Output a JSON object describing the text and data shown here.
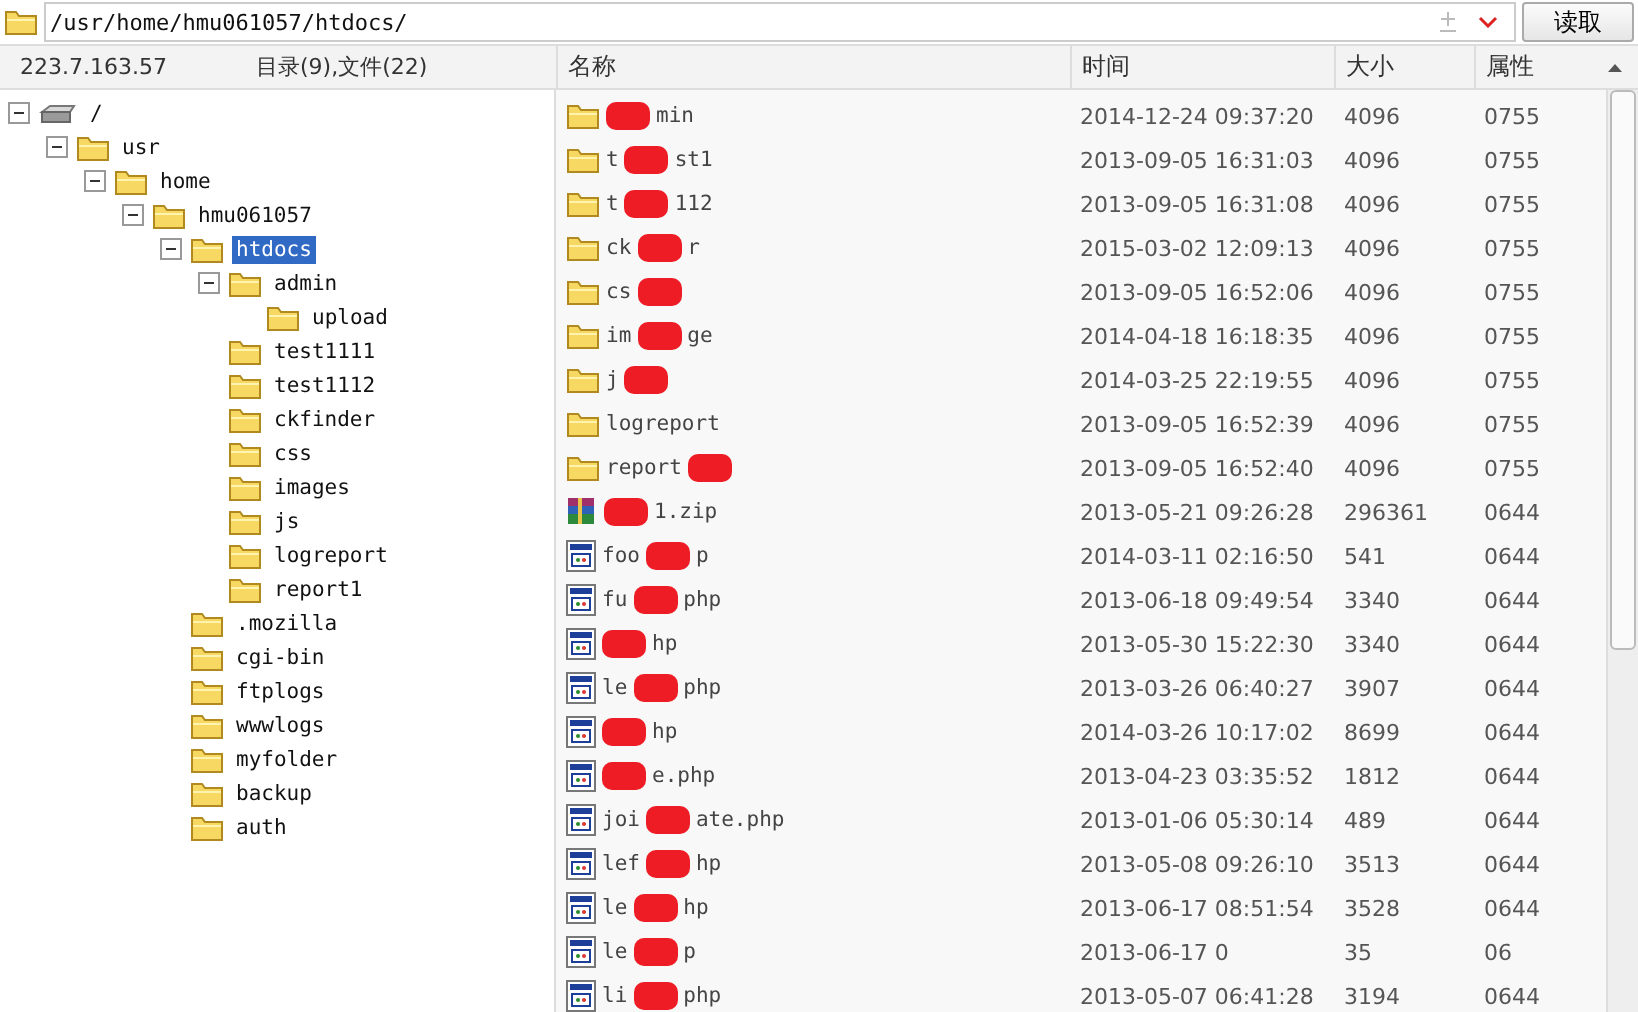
{
  "address_bar": {
    "path": "/usr/home/hmu061057/htdocs/",
    "button": "读取"
  },
  "status": {
    "host": "223.7.163.57",
    "counts": "目录(9),文件(22)"
  },
  "tree": [
    {
      "label": "/",
      "kind": "drive",
      "expanded": true,
      "selected": false,
      "children": [
        {
          "label": "usr",
          "kind": "folder",
          "expanded": true,
          "selected": false,
          "children": [
            {
              "label": "home",
              "kind": "folder",
              "expanded": true,
              "selected": false,
              "children": [
                {
                  "label": "hmu061057",
                  "kind": "folder",
                  "expanded": true,
                  "selected": false,
                  "children": [
                    {
                      "label": "htdocs",
                      "kind": "folder",
                      "expanded": true,
                      "selected": true,
                      "children": [
                        {
                          "label": "admin",
                          "kind": "folder",
                          "expanded": true,
                          "selected": false,
                          "children": [
                            {
                              "label": "upload",
                              "kind": "folder",
                              "selected": false
                            }
                          ]
                        },
                        {
                          "label": "test1111",
                          "kind": "folder",
                          "selected": false
                        },
                        {
                          "label": "test1112",
                          "kind": "folder",
                          "selected": false
                        },
                        {
                          "label": "ckfinder",
                          "kind": "folder",
                          "selected": false
                        },
                        {
                          "label": "css",
                          "kind": "folder",
                          "selected": false
                        },
                        {
                          "label": "images",
                          "kind": "folder",
                          "selected": false
                        },
                        {
                          "label": "js",
                          "kind": "folder",
                          "selected": false
                        },
                        {
                          "label": "logreport",
                          "kind": "folder",
                          "selected": false
                        },
                        {
                          "label": "report1",
                          "kind": "folder",
                          "selected": false
                        }
                      ]
                    },
                    {
                      "label": ".mozilla",
                      "kind": "folder",
                      "selected": false
                    },
                    {
                      "label": "cgi-bin",
                      "kind": "folder",
                      "selected": false
                    },
                    {
                      "label": "ftplogs",
                      "kind": "folder",
                      "selected": false
                    },
                    {
                      "label": "wwwlogs",
                      "kind": "folder",
                      "selected": false
                    },
                    {
                      "label": "myfolder",
                      "kind": "folder",
                      "selected": false
                    },
                    {
                      "label": "backup",
                      "kind": "folder",
                      "selected": false
                    },
                    {
                      "label": "auth",
                      "kind": "folder",
                      "selected": false
                    }
                  ]
                }
              ]
            }
          ]
        }
      ]
    }
  ],
  "table": {
    "columns": [
      "名称",
      "时间",
      "大小",
      "属性"
    ],
    "rows": [
      {
        "kind": "folder",
        "name_before": "",
        "name_after": "min",
        "redacted": true,
        "time": "2014-12-24 09:37:20",
        "size": "4096",
        "mode": "0755"
      },
      {
        "kind": "folder",
        "name_before": "t",
        "name_after": "st1",
        "redacted": true,
        "time": "2013-09-05 16:31:03",
        "size": "4096",
        "mode": "0755"
      },
      {
        "kind": "folder",
        "name_before": "t",
        "name_after": "112",
        "redacted": true,
        "time": "2013-09-05 16:31:08",
        "size": "4096",
        "mode": "0755"
      },
      {
        "kind": "folder",
        "name_before": "ck",
        "name_after": "r",
        "redacted": true,
        "time": "2015-03-02 12:09:13",
        "size": "4096",
        "mode": "0755"
      },
      {
        "kind": "folder",
        "name_before": "cs",
        "name_after": "",
        "redacted": true,
        "time": "2013-09-05 16:52:06",
        "size": "4096",
        "mode": "0755"
      },
      {
        "kind": "folder",
        "name_before": "im",
        "name_after": "ge",
        "redacted": true,
        "time": "2014-04-18 16:18:35",
        "size": "4096",
        "mode": "0755"
      },
      {
        "kind": "folder",
        "name_before": "j",
        "name_after": "",
        "redacted": true,
        "time": "2014-03-25 22:19:55",
        "size": "4096",
        "mode": "0755"
      },
      {
        "kind": "folder",
        "name_before": "logreport",
        "name_after": "",
        "redacted": false,
        "time": "2013-09-05 16:52:39",
        "size": "4096",
        "mode": "0755"
      },
      {
        "kind": "folder",
        "name_before": "report",
        "name_after": "",
        "redacted": true,
        "time": "2013-09-05 16:52:40",
        "size": "4096",
        "mode": "0755"
      },
      {
        "kind": "archive",
        "name_before": "",
        "name_after": "1.zip",
        "redacted": true,
        "time": "2013-05-21 09:26:28",
        "size": "296361",
        "mode": "0644"
      },
      {
        "kind": "script",
        "name_before": "foo",
        "name_after": "p",
        "redacted": true,
        "time": "2014-03-11 02:16:50",
        "size": "541",
        "mode": "0644"
      },
      {
        "kind": "script",
        "name_before": "fu",
        "name_after": "php",
        "redacted": true,
        "time": "2013-06-18 09:49:54",
        "size": "3340",
        "mode": "0644"
      },
      {
        "kind": "script",
        "name_before": "",
        "name_after": "hp",
        "redacted": true,
        "time": "2013-05-30 15:22:30",
        "size": "3340",
        "mode": "0644"
      },
      {
        "kind": "script",
        "name_before": "le",
        "name_after": "php",
        "redacted": true,
        "time": "2013-03-26 06:40:27",
        "size": "3907",
        "mode": "0644"
      },
      {
        "kind": "script",
        "name_before": "",
        "name_after": "hp",
        "redacted": true,
        "time": "2014-03-26 10:17:02",
        "size": "8699",
        "mode": "0644"
      },
      {
        "kind": "script",
        "name_before": "",
        "name_after": "e.php",
        "redacted": true,
        "time": "2013-04-23 03:35:52",
        "size": "1812",
        "mode": "0644"
      },
      {
        "kind": "script",
        "name_before": "joi",
        "name_after": "ate.php",
        "redacted": true,
        "time": "2013-01-06 05:30:14",
        "size": "489",
        "mode": "0644"
      },
      {
        "kind": "script",
        "name_before": "lef",
        "name_after": "hp",
        "redacted": true,
        "time": "2013-05-08 09:26:10",
        "size": "3513",
        "mode": "0644"
      },
      {
        "kind": "script",
        "name_before": "le",
        "name_after": "hp",
        "redacted": true,
        "time": "2013-06-17 08:51:54",
        "size": "3528",
        "mode": "0644"
      },
      {
        "kind": "script",
        "name_before": "le",
        "name_after": "p",
        "redacted": true,
        "time": "2013-06-17 0",
        "size": "35",
        "mode": "06"
      },
      {
        "kind": "script",
        "name_before": "li",
        "name_after": "php",
        "redacted": true,
        "time": "2013-05-07 06:41:28",
        "size": "3194",
        "mode": "0644"
      }
    ]
  }
}
